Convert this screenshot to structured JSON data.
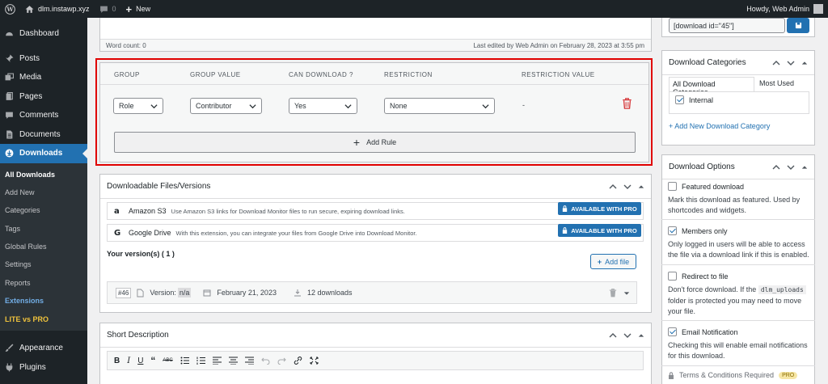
{
  "adminbar": {
    "site": "dlm.instawp.xyz",
    "comments": "0",
    "new": "New",
    "howdy": "Howdy, Web Admin"
  },
  "menu": {
    "dashboard": "Dashboard",
    "posts": "Posts",
    "media": "Media",
    "pages": "Pages",
    "comments": "Comments",
    "documents": "Documents",
    "downloads": "Downloads",
    "sub": [
      "All Downloads",
      "Add New",
      "Categories",
      "Tags",
      "Global Rules",
      "Settings",
      "Reports",
      "Extensions",
      "LITE vs PRO"
    ],
    "appearance": "Appearance",
    "plugins": "Plugins"
  },
  "editor": {
    "word_count": "Word count: 0",
    "last_edited": "Last edited by Web Admin on February 28, 2023 at 3:55 pm"
  },
  "rules": {
    "headers": [
      "GROUP",
      "GROUP VALUE",
      "CAN DOWNLOAD ?",
      "RESTRICTION",
      "RESTRICTION VALUE"
    ],
    "row": {
      "group": "Role",
      "group_value": "Contributor",
      "can_download": "Yes",
      "restriction": "None",
      "restriction_value": "-"
    },
    "add_rule": "Add Rule"
  },
  "files": {
    "title": "Downloadable Files/Versions",
    "ext": [
      {
        "name": "Amazon S3",
        "desc": "Use Amazon S3 links for Download Monitor files to run secure, expiring download links.",
        "badge": "AVAILABLE WITH PRO"
      },
      {
        "name": "Google Drive",
        "desc": "With this extension, you can integrate your files from Google Drive into Download Monitor.",
        "badge": "AVAILABLE WITH PRO"
      }
    ],
    "versions_label": "Your version(s) ( 1 )",
    "add_file": "Add file",
    "version": {
      "id": "#46",
      "version_label": "Version:",
      "version_value": "n/a",
      "date": "February 21, 2023",
      "downloads": "12 downloads"
    }
  },
  "short_desc": {
    "title": "Short Description"
  },
  "shortcode": {
    "value": "[download id=\"45\"]"
  },
  "categories": {
    "title": "Download Categories",
    "tab_all": "All Download Categories",
    "tab_used": "Most Used",
    "items": [
      {
        "label": "Internal",
        "checked": true
      }
    ],
    "add_new": "+ Add New Download Category"
  },
  "options": {
    "title": "Download Options",
    "featured": {
      "label": "Featured download",
      "desc": "Mark this download as featured. Used by shortcodes and widgets."
    },
    "members": {
      "label": "Members only",
      "desc": "Only logged in users will be able to access the file via a download link if this is enabled."
    },
    "redirect": {
      "label": "Redirect to file",
      "desc_a": "Don't force download. If the",
      "code": "dlm_uploads",
      "desc_b": "folder is protected you may need to move your file."
    },
    "email": {
      "label": "Email Notification",
      "desc": "Checking this will enable email notifications for this download."
    },
    "terms": {
      "label": "Terms & Conditions Required",
      "badge": "PRO"
    }
  },
  "colors": {
    "accent": "#2271b1",
    "highlight": "#e00000",
    "trash": "#d63638"
  }
}
